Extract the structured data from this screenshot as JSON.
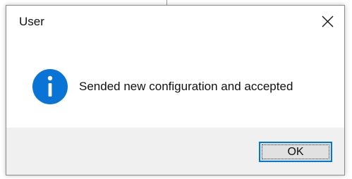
{
  "dialog": {
    "title": "User",
    "message": "Sended new configuration and accepted",
    "ok_label": "OK",
    "icon": "info-icon",
    "close_icon": "close-icon"
  },
  "colors": {
    "info_blue": "#0a74d6",
    "button_border": "#0078d7",
    "footer_bg": "#f0f0f0",
    "button_bg": "#e1e1e1"
  }
}
